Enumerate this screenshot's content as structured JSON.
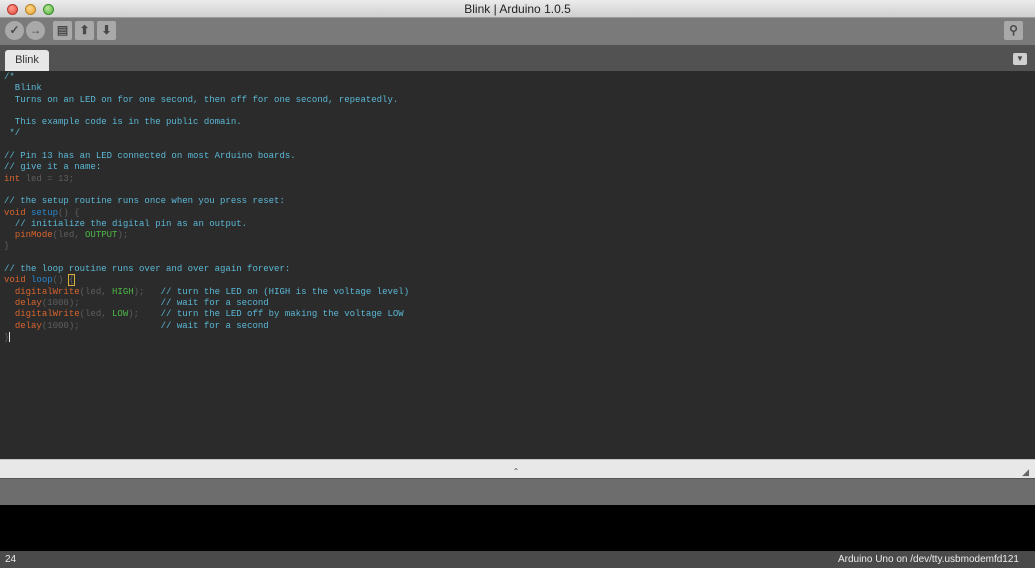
{
  "window": {
    "title": "Blink | Arduino 1.0.5"
  },
  "toolbar": {
    "buttons": [
      {
        "name": "verify",
        "glyph": "✓"
      },
      {
        "name": "upload",
        "glyph": "→"
      },
      {
        "name": "new",
        "glyph": "▤"
      },
      {
        "name": "open",
        "glyph": "⬆"
      },
      {
        "name": "save",
        "glyph": "⬇"
      }
    ],
    "serial_monitor_glyph": "⚲"
  },
  "tabs": [
    {
      "label": "Blink",
      "active": true
    }
  ],
  "tab_menu_glyph": "▼",
  "editor": {
    "code_lines": [
      [
        {
          "t": "/*",
          "c": "cm"
        }
      ],
      [
        {
          "t": "  Blink",
          "c": "cm"
        }
      ],
      [
        {
          "t": "  Turns on an LED on for one second, then off for one second, repeatedly.",
          "c": "cm"
        }
      ],
      [
        {
          "t": "",
          "c": "pl"
        }
      ],
      [
        {
          "t": "  This example code is in the public domain.",
          "c": "cm"
        }
      ],
      [
        {
          "t": " */",
          "c": "cm"
        }
      ],
      [
        {
          "t": "",
          "c": "pl"
        }
      ],
      [
        {
          "t": "// Pin 13 has an LED connected on most Arduino boards.",
          "c": "cm"
        }
      ],
      [
        {
          "t": "// give it a name:",
          "c": "cm"
        }
      ],
      [
        {
          "t": "int",
          "c": "kw"
        },
        {
          "t": " led = 13;",
          "c": "pl"
        }
      ],
      [
        {
          "t": "",
          "c": "pl"
        }
      ],
      [
        {
          "t": "// the setup routine runs once when you press reset:",
          "c": "cm"
        }
      ],
      [
        {
          "t": "void",
          "c": "kw"
        },
        {
          "t": " ",
          "c": "pl"
        },
        {
          "t": "setup",
          "c": "st"
        },
        {
          "t": "() {",
          "c": "pl"
        }
      ],
      [
        {
          "t": "  ",
          "c": "pl"
        },
        {
          "t": "// initialize the digital pin as an output.",
          "c": "cm"
        }
      ],
      [
        {
          "t": "  ",
          "c": "pl"
        },
        {
          "t": "pinMode",
          "c": "fn"
        },
        {
          "t": "(led, ",
          "c": "pl"
        },
        {
          "t": "OUTPUT",
          "c": "ct"
        },
        {
          "t": ");",
          "c": "pl"
        }
      ],
      [
        {
          "t": "}",
          "c": "pl"
        }
      ],
      [
        {
          "t": "",
          "c": "pl"
        }
      ],
      [
        {
          "t": "// the loop routine runs over and over again forever:",
          "c": "cm"
        }
      ],
      [
        {
          "t": "void",
          "c": "kw"
        },
        {
          "t": " ",
          "c": "pl"
        },
        {
          "t": "loop",
          "c": "st"
        },
        {
          "t": "() ",
          "c": "pl"
        },
        {
          "t": "{",
          "c": "pl",
          "box": true
        }
      ],
      [
        {
          "t": "  ",
          "c": "pl"
        },
        {
          "t": "digitalWrite",
          "c": "fn"
        },
        {
          "t": "(led, ",
          "c": "pl"
        },
        {
          "t": "HIGH",
          "c": "ct"
        },
        {
          "t": ");   ",
          "c": "pl"
        },
        {
          "t": "// turn the LED on (HIGH is the voltage level)",
          "c": "cm"
        }
      ],
      [
        {
          "t": "  ",
          "c": "pl"
        },
        {
          "t": "delay",
          "c": "fn"
        },
        {
          "t": "(1000);               ",
          "c": "pl"
        },
        {
          "t": "// wait for a second",
          "c": "cm"
        }
      ],
      [
        {
          "t": "  ",
          "c": "pl"
        },
        {
          "t": "digitalWrite",
          "c": "fn"
        },
        {
          "t": "(led, ",
          "c": "pl"
        },
        {
          "t": "LOW",
          "c": "ct"
        },
        {
          "t": ");    ",
          "c": "pl"
        },
        {
          "t": "// turn the LED off by making the voltage LOW",
          "c": "cm"
        }
      ],
      [
        {
          "t": "  ",
          "c": "pl"
        },
        {
          "t": "delay",
          "c": "fn"
        },
        {
          "t": "(1000);               ",
          "c": "pl"
        },
        {
          "t": "// wait for a second",
          "c": "cm"
        }
      ],
      [
        {
          "t": "}",
          "c": "pl",
          "caret": true
        }
      ]
    ]
  },
  "divider": {
    "grip_glyph": "⌃",
    "corner_glyph": "◢"
  },
  "status": {
    "line_number": "24",
    "board_port": "Arduino Uno on /dev/tty.usbmodemfd121"
  },
  "colors": {
    "comment": "#5bb8d6",
    "keyword": "#d9652d",
    "structure_fn": "#2a87cf",
    "constant": "#4db948",
    "plain": "#5e5e5e",
    "editor_bg": "#2b2b2b"
  }
}
